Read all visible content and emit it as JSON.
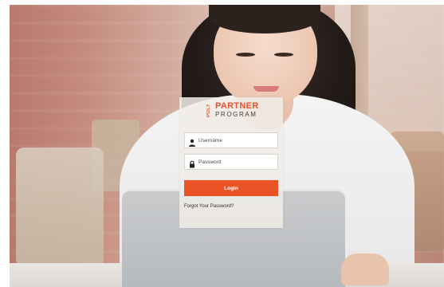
{
  "logo": {
    "poly": "POLY",
    "partner": "PARTNER",
    "program": "PROGRAM"
  },
  "login_form": {
    "username_placeholder": "Username",
    "password_placeholder": "Password",
    "login_label": "Login",
    "forgot_password_label": "Forgot Your Password?"
  },
  "colors": {
    "accent": "#ea5325",
    "panel": "#f0ece8"
  },
  "icons": {
    "username": "user-icon",
    "password": "lock-icon"
  }
}
